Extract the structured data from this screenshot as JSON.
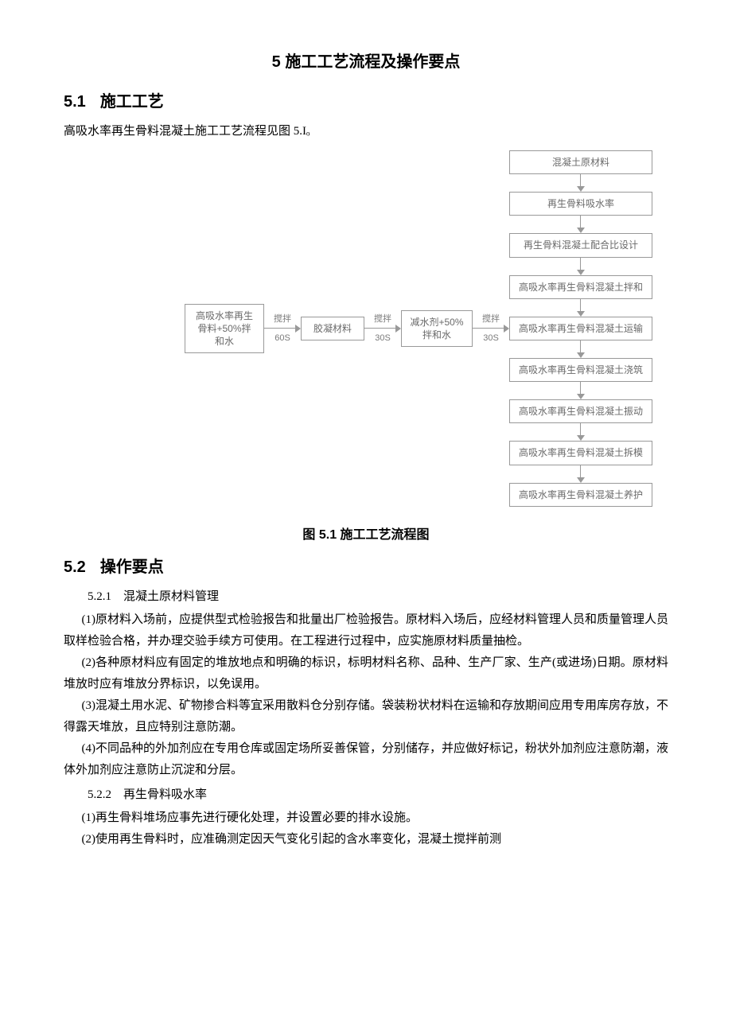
{
  "chapter": {
    "num": "5",
    "title": "施工工艺流程及操作要点"
  },
  "s51": {
    "num": "5.1",
    "title": "施工工艺"
  },
  "intro": "高吸水率再生骨料混凝土施工工艺流程见图 5.Iₒ",
  "diagram": {
    "left": {
      "n1": "高吸水率再生骨料+50%拌和水",
      "n2": "胶凝材料",
      "n3": "减水剂+50%拌和水",
      "a1": {
        "top": "搅拌",
        "bot": "60S"
      },
      "a2": {
        "top": "搅拌",
        "bot": "30S"
      },
      "a3": {
        "top": "搅拌",
        "bot": "30S"
      }
    },
    "right": {
      "r1": "混凝土原材料",
      "r2": "再生骨料吸水率",
      "r3": "再生骨料混凝土配合比设计",
      "r4": "高吸水率再生骨料混凝土拌和",
      "r5": "高吸水率再生骨料混凝土运输",
      "r6": "高吸水率再生骨料混凝土浇筑",
      "r7": "高吸水率再生骨料混凝土振动",
      "r8": "高吸水率再生骨料混凝土拆模",
      "r9": "高吸水率再生骨料混凝土养护"
    }
  },
  "fig_caption": "图 5.1 施工工艺流程图",
  "s52": {
    "num": "5.2",
    "title": "操作要点"
  },
  "s521": "5.2.1　混凝土原材料管理",
  "p1": "(1)原材料入场前，应提供型式检验报告和批量出厂检验报告。原材料入场后，应经材料管理人员和质量管理人员取样检验合格，并办理交验手续方可使用。在工程进行过程中，应实施原材料质量抽检。",
  "p2": "(2)各种原材料应有固定的堆放地点和明确的标识，标明材料名称、品种、生产厂家、生产(或进场)日期。原材料堆放时应有堆放分界标识，以免误用。",
  "p3": "(3)混凝土用水泥、矿物掺合料等宜采用散料仓分别存储。袋装粉状材料在运输和存放期间应用专用库房存放，不得露天堆放，且应特别注意防潮。",
  "p4": "(4)不同品种的外加剂应在专用仓库或固定场所妥善保管，分别储存，并应做好标记，粉状外加剂应注意防潮，液体外加剂应注意防止沉淀和分层。",
  "s522": "5.2.2　再生骨料吸水率",
  "p5": "(1)再生骨料堆场应事先进行硬化处理，并设置必要的排水设施。",
  "p6": "(2)使用再生骨料时，应准确测定因天气变化引起的含水率变化，混凝土搅拌前测"
}
